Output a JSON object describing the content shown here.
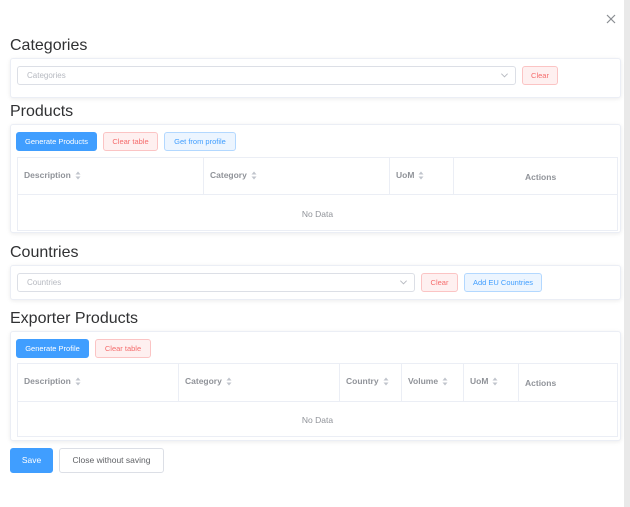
{
  "dialog": {
    "close_icon": "close-icon"
  },
  "categories": {
    "title": "Categories",
    "select_placeholder": "Categories",
    "clear_label": "Clear"
  },
  "products": {
    "title": "Products",
    "generate_label": "Generate Products",
    "clear_table_label": "Clear table",
    "get_from_profile_label": "Get from profile",
    "columns": [
      "Description",
      "Category",
      "UoM",
      "Actions"
    ],
    "empty_text": "No Data"
  },
  "countries": {
    "title": "Countries",
    "select_placeholder": "Countries",
    "clear_label": "Clear",
    "add_eu_label": "Add EU Countries"
  },
  "exporter_products": {
    "title": "Exporter Products",
    "generate_label": "Generate Profile",
    "clear_table_label": "Clear table",
    "columns": [
      "Description",
      "Category",
      "Country",
      "Volume",
      "UoM",
      "Actions"
    ],
    "empty_text": "No Data"
  },
  "footer": {
    "save_label": "Save",
    "close_without_saving_label": "Close without saving"
  },
  "colors": {
    "primary": "#409eff",
    "danger": "#f56c6c",
    "text": "#303133",
    "muted": "#909399",
    "border": "#ebeef5"
  }
}
